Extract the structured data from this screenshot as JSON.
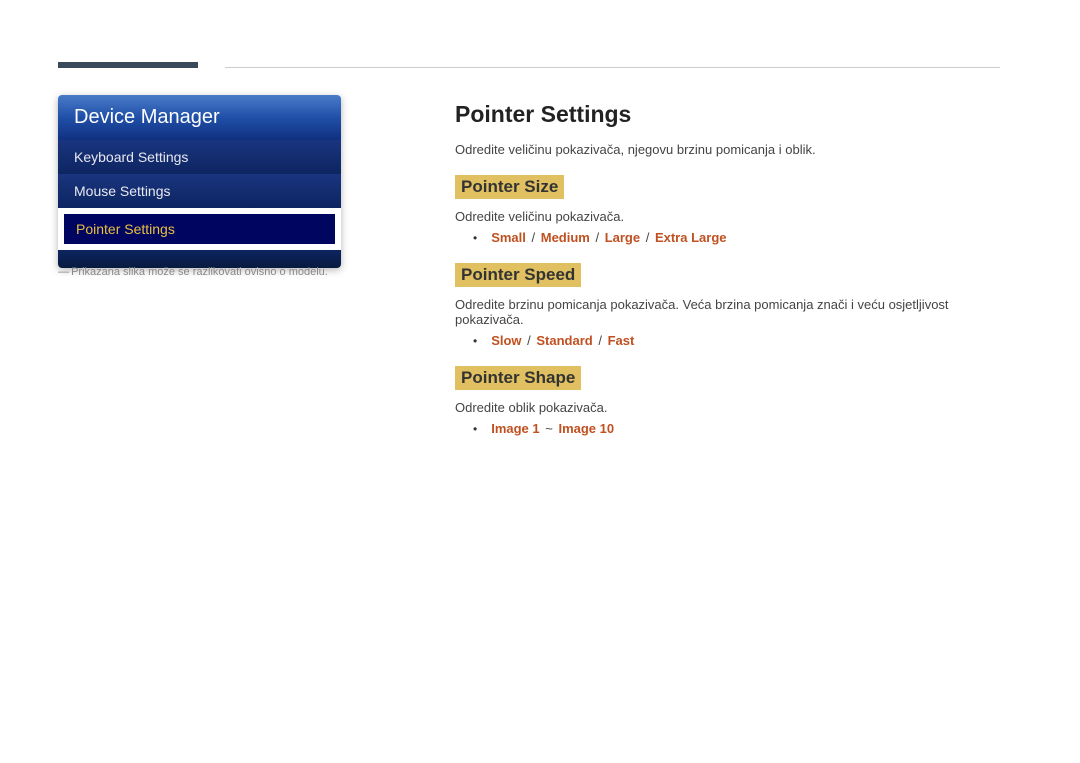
{
  "sidebar": {
    "title": "Device Manager",
    "items": [
      {
        "label": "Keyboard Settings",
        "selected": false
      },
      {
        "label": "Mouse Settings",
        "selected": false
      },
      {
        "label": "Pointer Settings",
        "selected": true
      }
    ],
    "note": "Prikazana slika može se razlikovati ovisno o modelu."
  },
  "content": {
    "heading": "Pointer Settings",
    "intro": "Odredite veličinu pokazivača, njegovu brzinu pomicanja i oblik.",
    "sections": [
      {
        "heading": "Pointer Size",
        "text": "Odredite veličinu pokazivača.",
        "options": [
          "Small",
          "Medium",
          "Large",
          "Extra Large"
        ],
        "separator": " / "
      },
      {
        "heading": "Pointer Speed",
        "text": "Odredite brzinu pomicanja pokazivača. Veća brzina pomicanja znači i veću osjetljivost pokazivača.",
        "options": [
          "Slow",
          "Standard",
          "Fast"
        ],
        "separator": " / "
      },
      {
        "heading": "Pointer Shape",
        "text": "Odredite oblik pokazivača.",
        "options": [
          "Image 1",
          "Image 10"
        ],
        "separator": " ~ "
      }
    ]
  }
}
